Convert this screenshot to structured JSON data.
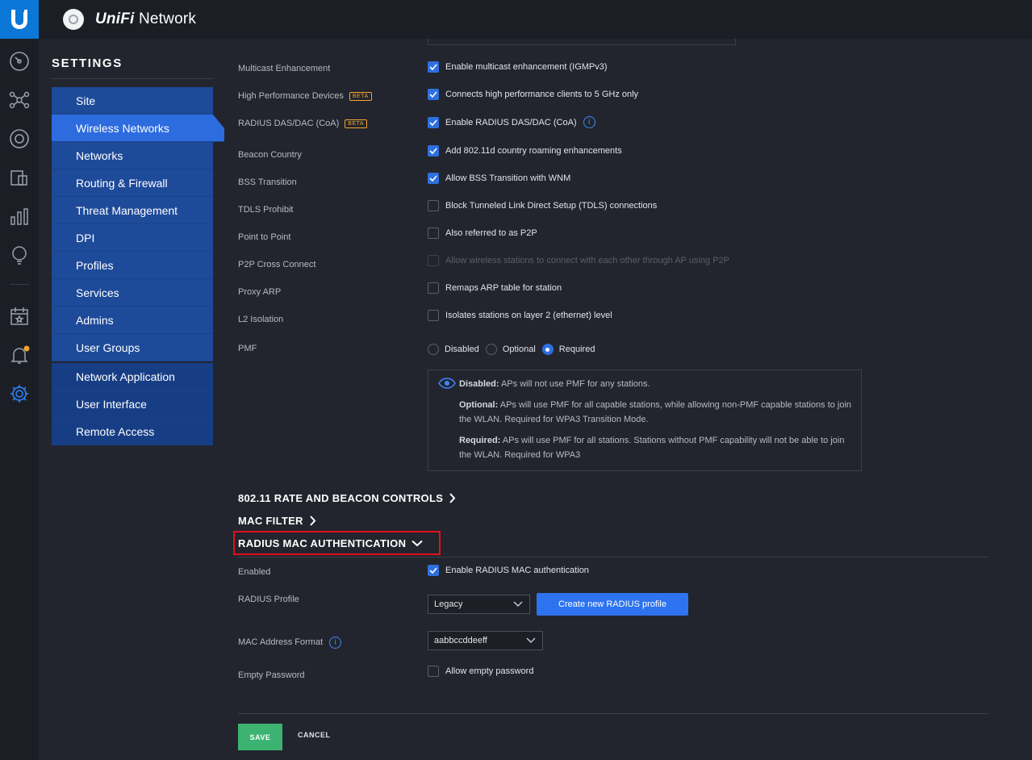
{
  "app": {
    "brand_prefix": "UniFi",
    "brand_suffix": " Network"
  },
  "settings": {
    "title": "SETTINGS",
    "nav": [
      {
        "label": "Site"
      },
      {
        "label": "Wireless Networks",
        "active": true
      },
      {
        "label": "Networks"
      },
      {
        "label": "Routing & Firewall"
      },
      {
        "label": "Threat Management"
      },
      {
        "label": "DPI"
      },
      {
        "label": "Profiles"
      },
      {
        "label": "Services"
      },
      {
        "label": "Admins"
      },
      {
        "label": "User Groups"
      }
    ],
    "nav2": [
      {
        "label": "Network Application"
      },
      {
        "label": "User Interface"
      },
      {
        "label": "Remote Access"
      }
    ]
  },
  "form": {
    "rows": [
      {
        "label": "Multicast Enhancement",
        "option": "Enable multicast enhancement (IGMPv3)",
        "checked": true
      },
      {
        "label": "High Performance Devices",
        "badge": "BETA",
        "option": "Connects high performance clients to 5 GHz only",
        "checked": true
      },
      {
        "label": "RADIUS DAS/DAC (CoA)",
        "badge": "BETA",
        "option": "Enable RADIUS DAS/DAC (CoA)",
        "checked": true
      },
      {
        "label": "Beacon Country",
        "option": "Add 802.11d country roaming enhancements",
        "checked": true
      },
      {
        "label": "BSS Transition",
        "option": "Allow BSS Transition with WNM",
        "checked": true
      },
      {
        "label": "TDLS Prohibit",
        "option": "Block Tunneled Link Direct Setup (TDLS) connections",
        "checked": false
      },
      {
        "label": "Point to Point",
        "option": "Also referred to as P2P",
        "checked": false
      },
      {
        "label": "P2P Cross Connect",
        "option": "Allow wireless stations to connect with each other through AP using P2P",
        "checked": false,
        "disabled": true
      },
      {
        "label": "Proxy ARP",
        "option": "Remaps ARP table for station",
        "checked": false
      },
      {
        "label": "L2 Isolation",
        "option": "Isolates stations on layer 2 (ethernet) level",
        "checked": false
      }
    ],
    "pmf": {
      "label": "PMF",
      "options": [
        "Disabled",
        "Optional",
        "Required"
      ],
      "selected": "Required",
      "help": {
        "disabled_term": "Disabled:",
        "disabled_text": " APs will not use PMF for any stations.",
        "optional_term": "Optional:",
        "optional_text": " APs will use PMF for all capable stations, while allowing non-PMF capable stations to join the WLAN. Required for WPA3 Transition Mode.",
        "required_term": "Required:",
        "required_text": " APs will use PMF for all stations. Stations without PMF capability will not be able to join the WLAN. Required for WPA3"
      }
    }
  },
  "sections": {
    "rate_beacon": "802.11 RATE AND BEACON CONTROLS",
    "mac_filter": "MAC FILTER",
    "radius_mac": "RADIUS MAC AUTHENTICATION"
  },
  "radius": {
    "enabled_label": "Enabled",
    "enabled_option": "Enable RADIUS MAC authentication",
    "profile_label": "RADIUS Profile",
    "profile_value": "Legacy",
    "create_button": "Create new RADIUS profile",
    "mac_format_label": "MAC Address Format",
    "mac_format_value": "aabbccddeeff",
    "empty_pw_label": "Empty Password",
    "empty_pw_option": "Allow empty password"
  },
  "footer": {
    "save": "SAVE",
    "cancel": "CANCEL"
  },
  "colors": {
    "accent": "#2d6cdf",
    "save": "#3cb371",
    "highlight": "#e3101c",
    "beta": "#f3a533"
  }
}
